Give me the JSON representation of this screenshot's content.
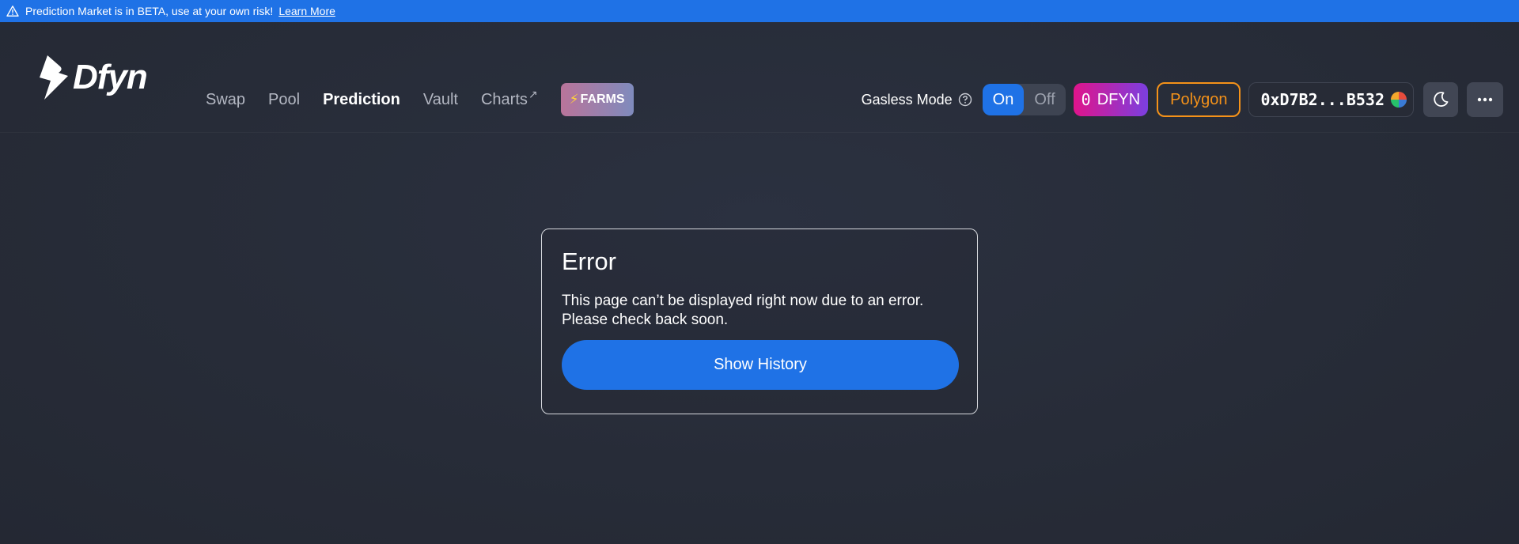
{
  "banner": {
    "text": "Prediction Market is in BETA, use at your own risk!",
    "link": "Learn More",
    "icon": "warning-icon",
    "color": "#1f72e6"
  },
  "brand": {
    "name": "Dfyn",
    "icon": "lightning-bolt-logo"
  },
  "nav": {
    "items": [
      {
        "label": "Swap"
      },
      {
        "label": "Pool"
      },
      {
        "label": "Prediction",
        "active": true
      },
      {
        "label": "Vault"
      },
      {
        "label": "Charts",
        "external": "↗"
      }
    ],
    "farms": {
      "label": "FARMS",
      "icon": "lightning-icon"
    }
  },
  "toolbar": {
    "gasless_label": "Gasless Mode",
    "toggle_on": "On",
    "toggle_off": "Off",
    "dfyn_balance": "0",
    "dfyn_token": "DFYN",
    "network": "Polygon",
    "wallet": "0xD7B2...B532"
  },
  "error": {
    "title": "Error",
    "message": "This page can’t be displayed right now due to an error. Please check back soon.",
    "button": "Show History"
  },
  "colors": {
    "accent": "#1f72e6",
    "network": "#f59219",
    "background": "#272c38"
  }
}
